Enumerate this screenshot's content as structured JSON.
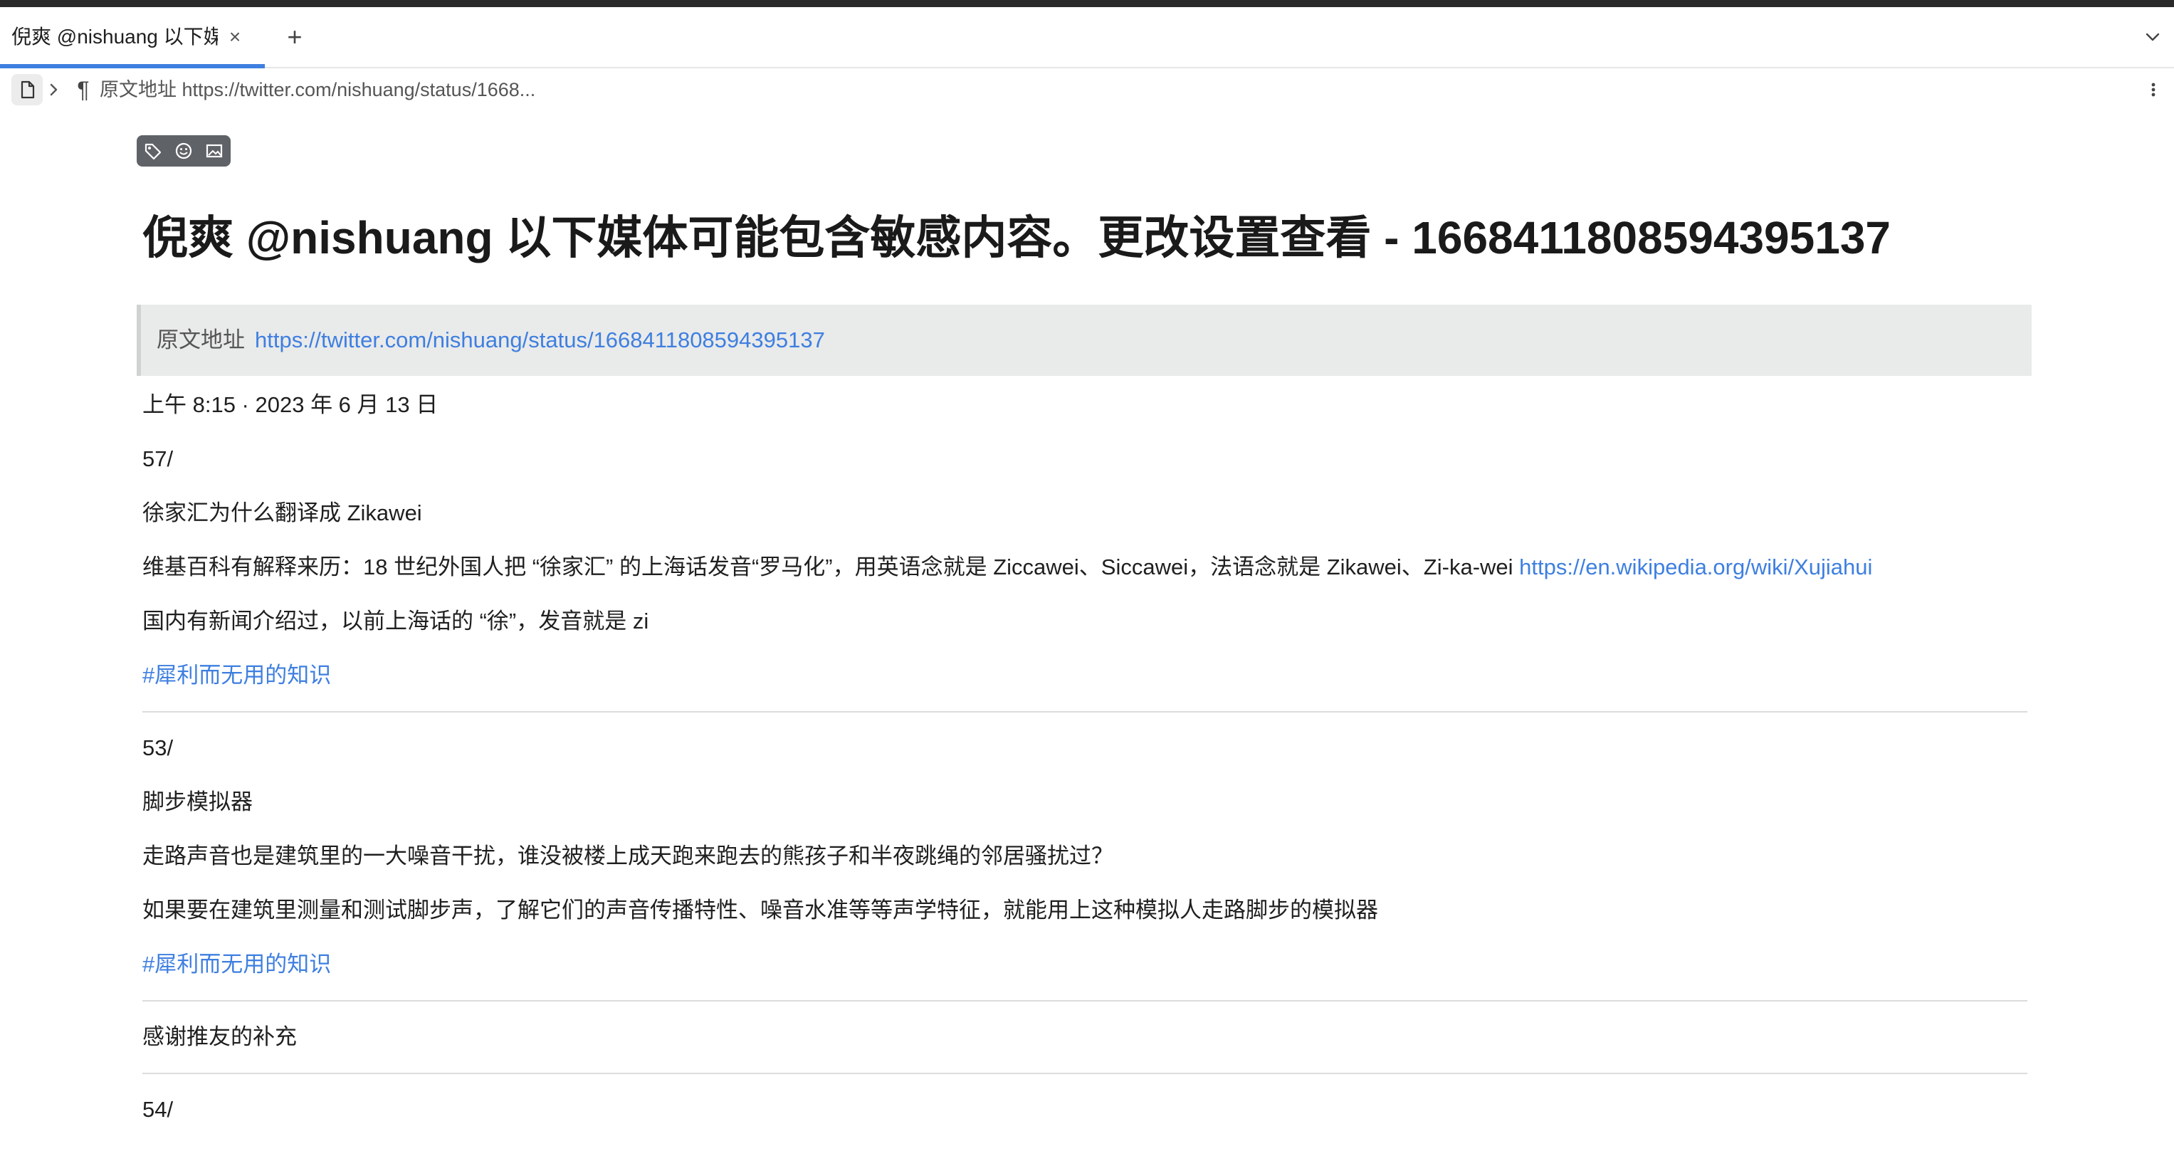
{
  "tab": {
    "title": "倪爽 @nishuang 以下媒",
    "close": "×",
    "add": "+"
  },
  "breadcrumb": {
    "para_symbol": "¶",
    "text": "原文地址 https://twitter.com/nishuang/status/1668..."
  },
  "toolbar": {
    "icons": [
      "tag-icon",
      "emoji-icon",
      "image-icon"
    ]
  },
  "article": {
    "title": "倪爽 @nishuang 以下媒体可能包含敏感内容。更改设置查看 - 1668411808594395137",
    "source_label": "原文地址",
    "source_url": "https://twitter.com/nishuang/status/1668411808594395137",
    "timestamp": "上午 8:15 · 2023 年 6 月 13 日",
    "sections": [
      {
        "number": "57/",
        "heading": "徐家汇为什么翻译成 Zikawei",
        "line1_text": "维基百科有解释来历：18 世纪外国人把 “徐家汇” 的上海话发音“罗马化”，用英语念就是 Ziccawei、Siccawei，法语念就是 Zikawei、Zi-ka-wei ",
        "line1_link": "https://en.wikipedia.org/wiki/Xujiahui",
        "line2": "国内有新闻介绍过，以前上海话的 “徐”，发音就是 zi",
        "tag": "#犀利而无用的知识"
      },
      {
        "number": "53/",
        "heading": "脚步模拟器",
        "line1": "走路声音也是建筑里的一大噪音干扰，谁没被楼上成天跑来跑去的熊孩子和半夜跳绳的邻居骚扰过？",
        "line2": "如果要在建筑里测量和测试脚步声，了解它们的声音传播特性、噪音水准等等声学特征，就能用上这种模拟人走路脚步的模拟器",
        "tag": "#犀利而无用的知识"
      }
    ],
    "thanks": "感谢推友的补充",
    "next_number": "54/"
  },
  "colors": {
    "link": "#3e7fe0",
    "tab_accent": "#3e7fe0",
    "quote_bg": "#e9eaea",
    "toolchip_bg": "#5f6368"
  }
}
